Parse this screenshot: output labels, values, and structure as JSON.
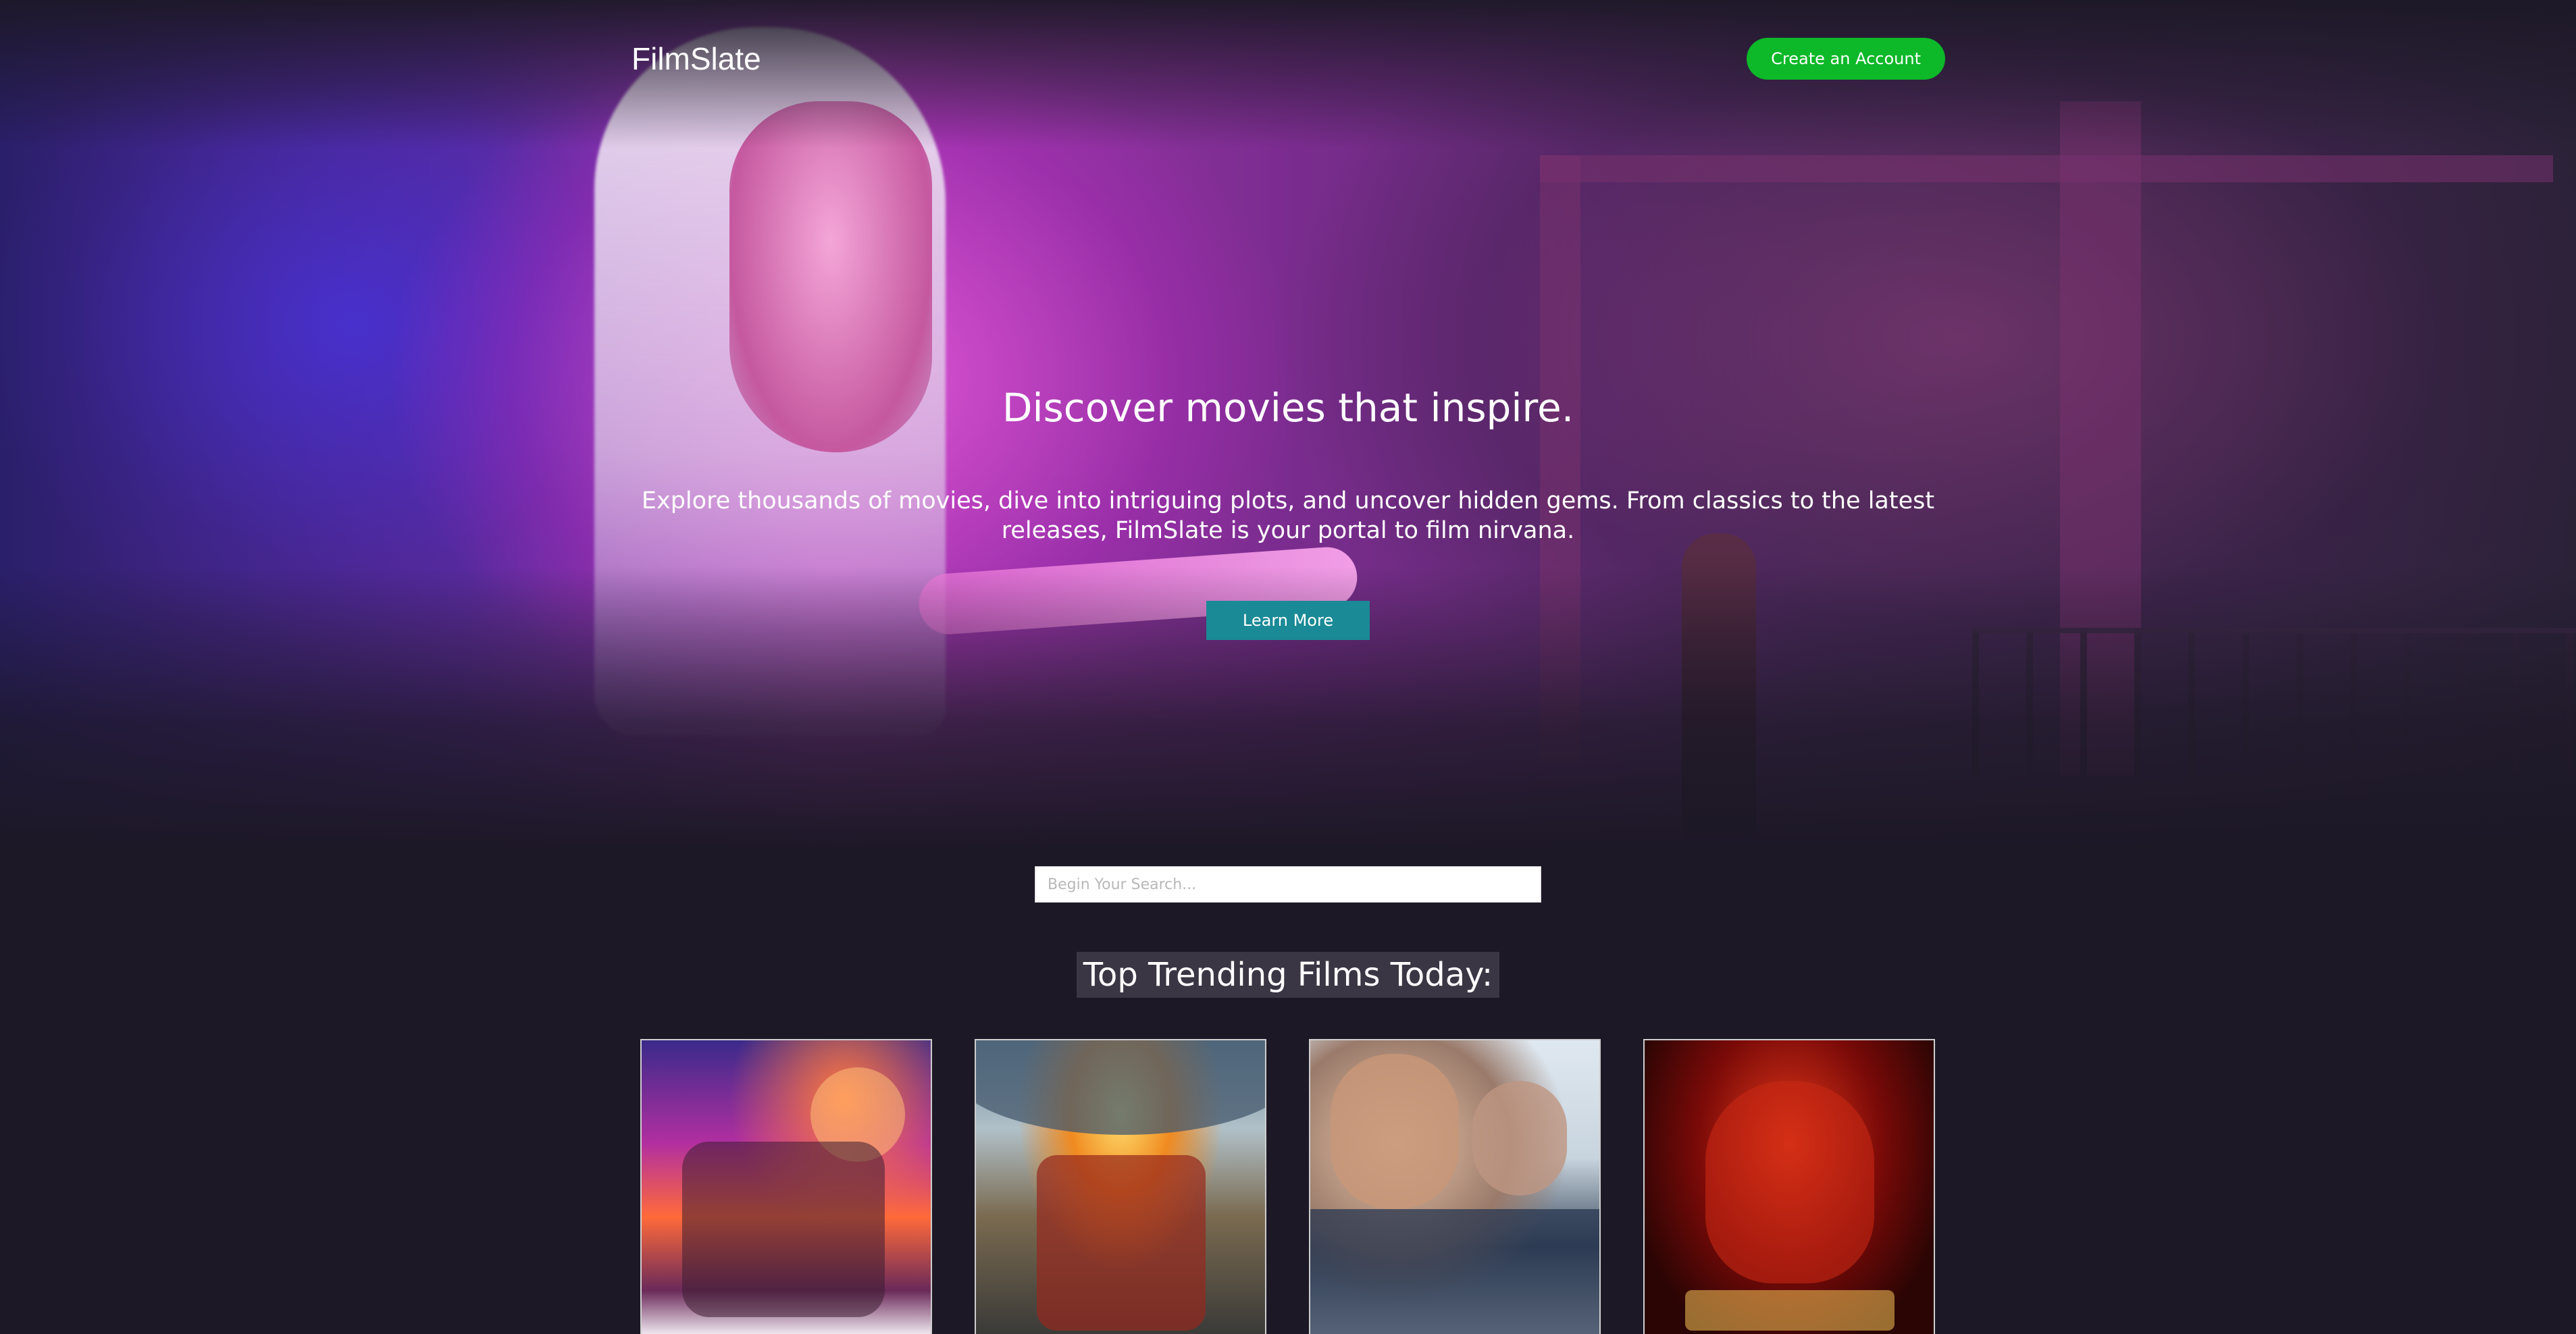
{
  "header": {
    "logo": "FilmSlate",
    "create_account_label": "Create an Account"
  },
  "hero": {
    "title": "Discover movies that inspire.",
    "description": "Explore thousands of movies, dive into intriguing plots, and uncover hidden gems. From classics to the latest releases, FilmSlate is your portal to film nirvana.",
    "learn_more_label": "Learn More"
  },
  "search": {
    "placeholder": "Begin Your Search...",
    "value": ""
  },
  "trending": {
    "title": "Top Trending Films Today:"
  },
  "colors": {
    "background": "#1c1826",
    "create_button": "#0db829",
    "learn_button": "#1a8a96",
    "trend_title_bg": "#3a3644"
  }
}
